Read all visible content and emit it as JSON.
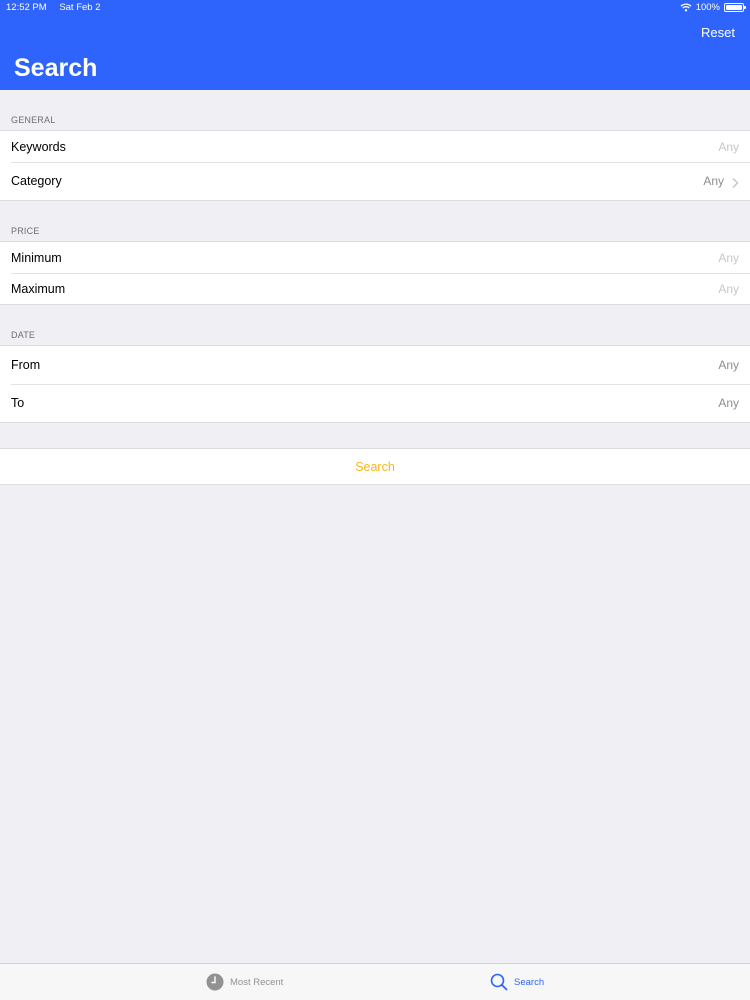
{
  "status_bar": {
    "time": "12:52 PM",
    "date": "Sat Feb 2",
    "battery": "100%",
    "battery_level": 1.0
  },
  "nav": {
    "title": "Search",
    "reset_label": "Reset"
  },
  "sections": {
    "general": {
      "header": "GENERAL",
      "keywords_label": "Keywords",
      "keywords_placeholder": "Any",
      "category_label": "Category",
      "category_value": "Any"
    },
    "price": {
      "header": "PRICE",
      "minimum_label": "Minimum",
      "minimum_placeholder": "Any",
      "maximum_label": "Maximum",
      "maximum_placeholder": "Any"
    },
    "date": {
      "header": "DATE",
      "from_label": "From",
      "from_value": "Any",
      "to_label": "To",
      "to_value": "Any"
    }
  },
  "search_button_label": "Search",
  "tab_bar": {
    "most_recent_label": "Most Recent",
    "search_label": "Search",
    "active_tab": "search"
  },
  "colors": {
    "nav_background": "#2e64fb",
    "accent_button": "#f6b91c",
    "active_tab": "#2e64fb",
    "inactive_tab": "#929292",
    "group_background": "#efeff4"
  },
  "icons": {
    "status_wifi": "wifi-icon",
    "status_battery": "battery-icon",
    "row_chevron": "chevron-right-icon",
    "tab_most_recent": "clock-icon",
    "tab_search": "search-icon"
  }
}
